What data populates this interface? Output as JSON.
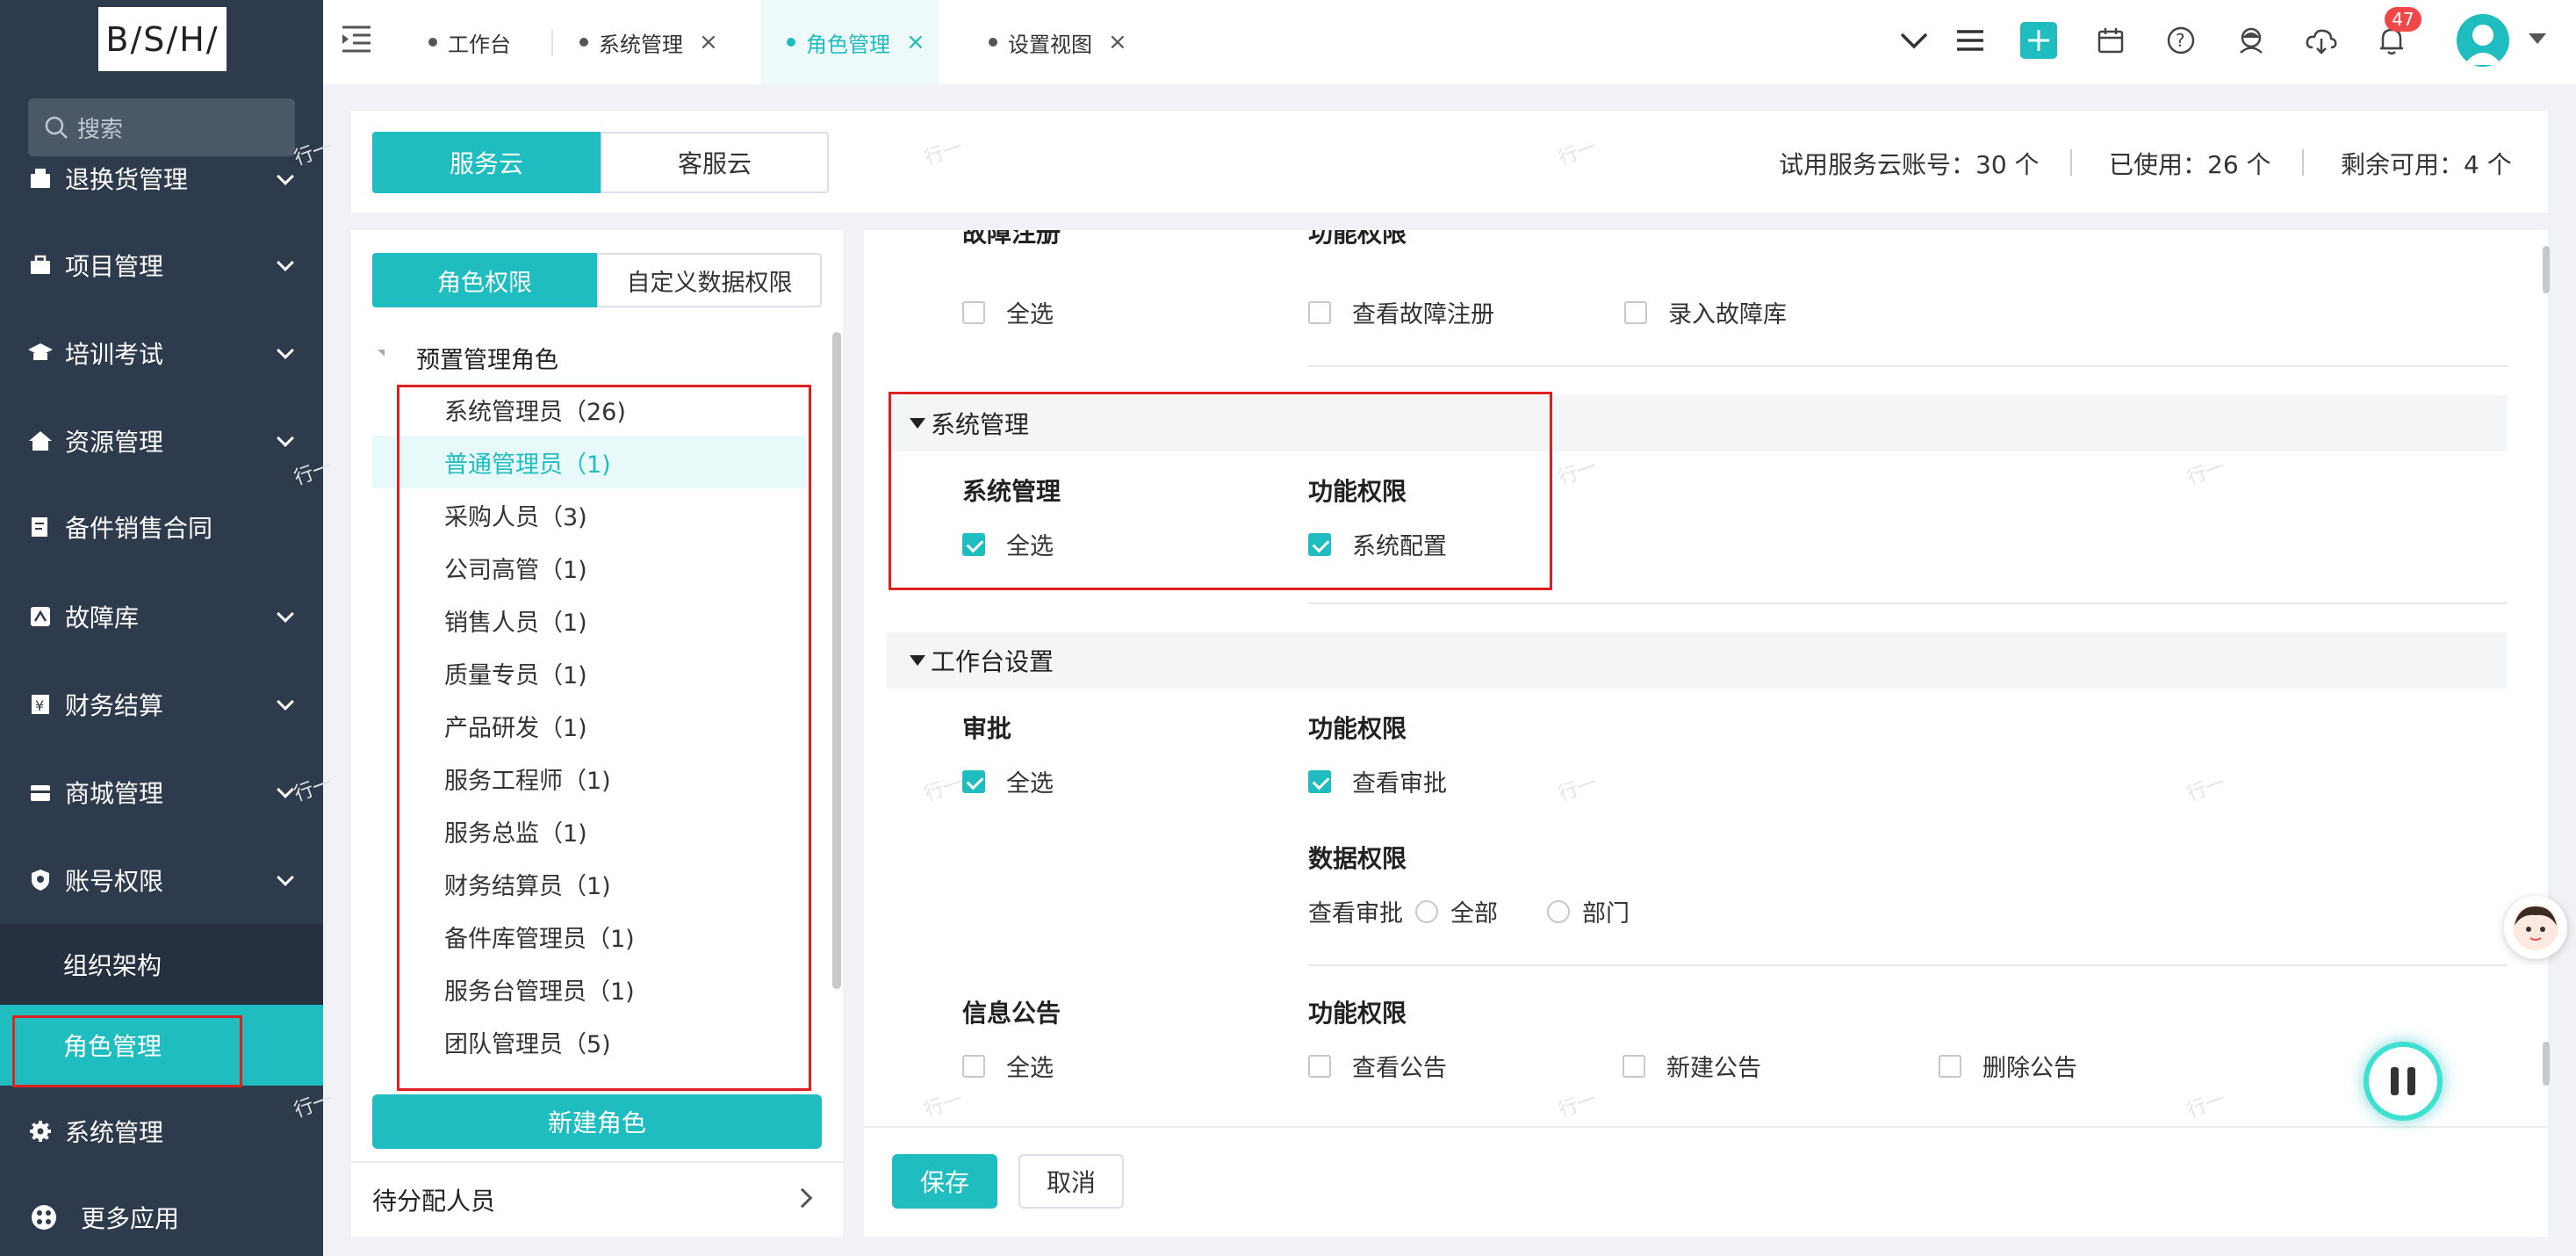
{
  "logo": "B/S/H/",
  "search": {
    "placeholder": "搜索"
  },
  "menu": [
    {
      "label": "退换货管理",
      "icon": "box-icon"
    },
    {
      "label": "项目管理",
      "icon": "briefcase-icon"
    },
    {
      "label": "培训考试",
      "icon": "graduation-cap-icon"
    },
    {
      "label": "资源管理",
      "icon": "house-icon"
    },
    {
      "label": "备件销售合同",
      "icon": "contract-icon"
    },
    {
      "label": "故障库",
      "icon": "fault-icon"
    },
    {
      "label": "财务结算",
      "icon": "yuan-icon"
    },
    {
      "label": "商城管理",
      "icon": "store-icon"
    },
    {
      "label": "账号权限",
      "icon": "shield-icon"
    }
  ],
  "submenu": [
    "组织架构",
    "角色管理"
  ],
  "menu_after": [
    {
      "label": "系统管理",
      "icon": "gear-icon"
    },
    {
      "label": "更多应用",
      "icon": "apps-icon"
    }
  ],
  "tabs": [
    {
      "label": "工作台"
    },
    {
      "label": "系统管理",
      "close": "×"
    },
    {
      "label": "角色管理",
      "close": "×"
    },
    {
      "label": "设置视图",
      "close": "×"
    }
  ],
  "notifications": {
    "count": "47"
  },
  "cloud_tabs": [
    "服务云",
    "客服云"
  ],
  "accounts": {
    "trial": "试用服务云账号：30 个",
    "used": "已使用：26 个",
    "remaining": "剩余可用：4 个"
  },
  "perm_tabs": [
    "角色权限",
    "自定义数据权限"
  ],
  "tree_root": "预置管理角色",
  "roles": [
    "系统管理员（26)",
    "普通管理员（1)",
    "采购人员（3)",
    "公司高管（1)",
    "销售人员（1)",
    "质量专员（1)",
    "产品研发（1)",
    "服务工程师（1)",
    "服务总监（1)",
    "财务结算员（1)",
    "备件库管理员（1)",
    "服务台管理员（1)",
    "团队管理员（5)"
  ],
  "new_role": "新建角色",
  "pending": "待分配人员",
  "fault": {
    "group": "故障注册",
    "func_header": "功能权限",
    "select_all": "全选",
    "perms": [
      "查看故障注册",
      "录入故障库"
    ]
  },
  "sys_section": {
    "title": "系统管理",
    "group": "系统管理",
    "func_header": "功能权限",
    "select_all": "全选",
    "perms": [
      "系统配置"
    ]
  },
  "workbench_section": {
    "title": "工作台设置",
    "approval": {
      "group": "审批",
      "func_header": "功能权限",
      "select_all": "全选",
      "perms": [
        "查看审批"
      ],
      "data_header": "数据权限",
      "data_label": "查看审批",
      "data_options": [
        "全部",
        "部门"
      ]
    },
    "notice": {
      "group": "信息公告",
      "func_header": "功能权限",
      "select_all": "全选",
      "perms": [
        "查看公告",
        "新建公告",
        "删除公告"
      ]
    }
  },
  "footer": {
    "save": "保存",
    "cancel": "取消"
  },
  "watermark": "行一",
  "colors": {
    "accent": "#1fbcc0",
    "sidebar": "#2e3b4c",
    "highlight": "#e02020",
    "badge": "#f04848"
  }
}
